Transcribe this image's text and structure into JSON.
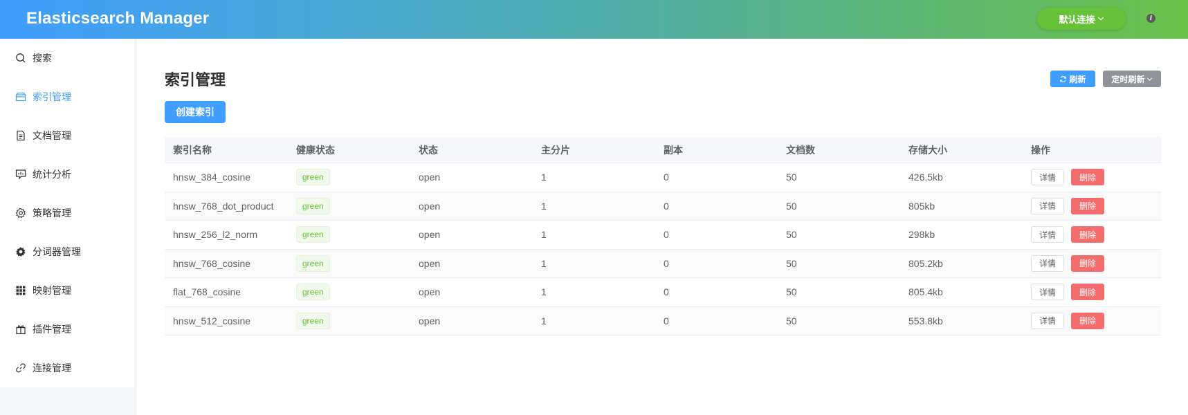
{
  "header": {
    "app_title": "Elasticsearch Manager",
    "connection_label": "默认连接",
    "info_glyph": "i"
  },
  "sidebar": {
    "items": [
      {
        "label": "搜索",
        "icon": "search-icon",
        "active": false
      },
      {
        "label": "索引管理",
        "icon": "box-icon",
        "active": true
      },
      {
        "label": "文档管理",
        "icon": "document-icon",
        "active": false
      },
      {
        "label": "统计分析",
        "icon": "chat-chart-icon",
        "active": false
      },
      {
        "label": "策略管理",
        "icon": "gear-icon",
        "active": false
      },
      {
        "label": "分词器管理",
        "icon": "cog-filled-icon",
        "active": false
      },
      {
        "label": "映射管理",
        "icon": "grid-icon",
        "active": false
      },
      {
        "label": "插件管理",
        "icon": "gift-icon",
        "active": false
      },
      {
        "label": "连接管理",
        "icon": "link-icon",
        "active": false
      }
    ]
  },
  "main": {
    "title": "索引管理",
    "refresh_label": "刷新",
    "timer_label": "定时刷新",
    "create_label": "创建索引",
    "table": {
      "columns": [
        "索引名称",
        "健康状态",
        "状态",
        "主分片",
        "副本",
        "文档数",
        "存储大小",
        "操作"
      ],
      "rows": [
        {
          "name": "hnsw_384_cosine",
          "health": "green",
          "status": "open",
          "primary": "1",
          "replica": "0",
          "docs": "50",
          "size": "426.5kb"
        },
        {
          "name": "hnsw_768_dot_product",
          "health": "green",
          "status": "open",
          "primary": "1",
          "replica": "0",
          "docs": "50",
          "size": "805kb"
        },
        {
          "name": "hnsw_256_l2_norm",
          "health": "green",
          "status": "open",
          "primary": "1",
          "replica": "0",
          "docs": "50",
          "size": "298kb"
        },
        {
          "name": "hnsw_768_cosine",
          "health": "green",
          "status": "open",
          "primary": "1",
          "replica": "0",
          "docs": "50",
          "size": "805.2kb"
        },
        {
          "name": "flat_768_cosine",
          "health": "green",
          "status": "open",
          "primary": "1",
          "replica": "0",
          "docs": "50",
          "size": "805.4kb"
        },
        {
          "name": "hnsw_512_cosine",
          "health": "green",
          "status": "open",
          "primary": "1",
          "replica": "0",
          "docs": "50",
          "size": "553.8kb"
        }
      ],
      "detail_label": "详情",
      "delete_label": "删除"
    }
  },
  "colors": {
    "primary": "#409eff",
    "success": "#67c23a",
    "danger": "#f56c6c",
    "info": "#909399"
  }
}
